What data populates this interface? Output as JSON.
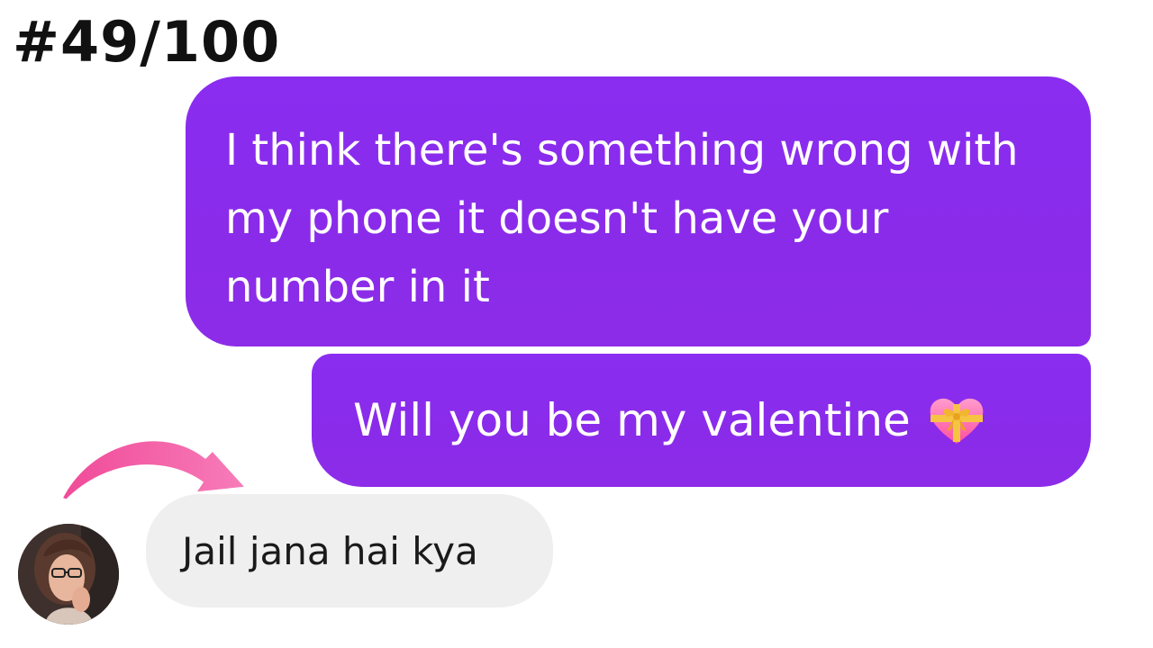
{
  "header": {
    "counter": "#49/100"
  },
  "conversation": {
    "outgoing": [
      {
        "text": "I think there's something wrong with my phone it doesn't have your number in it"
      },
      {
        "text": "Will you be my valentine",
        "emoji_icon": "heart-with-ribbon-icon"
      }
    ],
    "incoming": [
      {
        "text": "Jail jana hai kya",
        "avatar_icon": "user-avatar"
      }
    ]
  },
  "annotation": {
    "arrow_icon": "curved-arrow-icon"
  },
  "colors": {
    "outgoing_bubble": "#8a2bea",
    "incoming_bubble": "#efefef",
    "arrow": "#f06aa8",
    "heart": "#ff5fa8"
  }
}
